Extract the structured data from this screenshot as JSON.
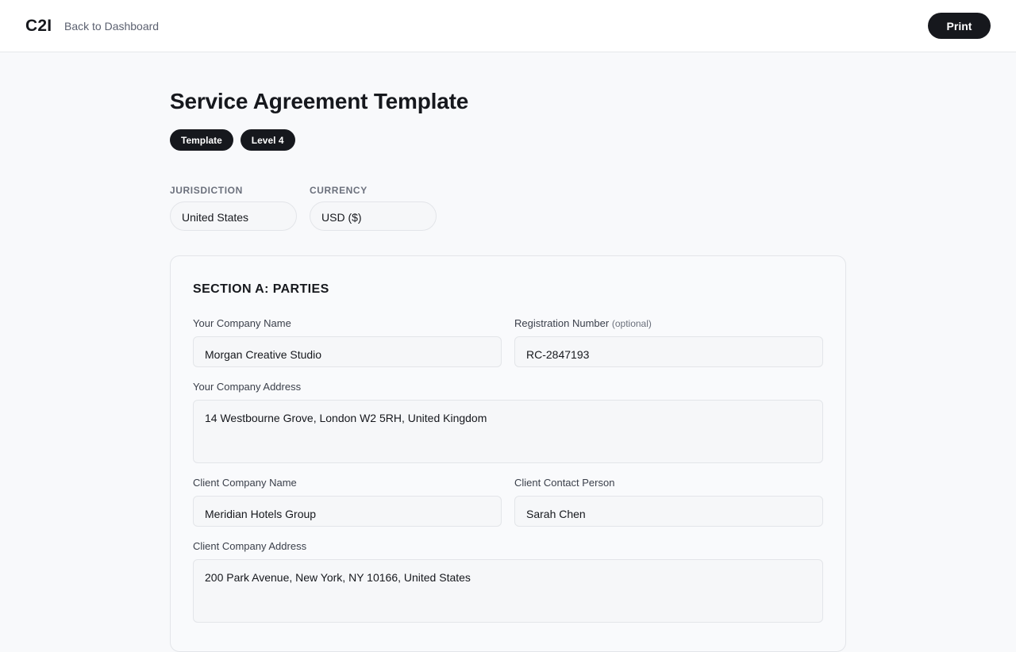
{
  "header": {
    "logo": "C2I",
    "back_link": "Back to Dashboard",
    "print_label": "Print"
  },
  "page": {
    "title": "Service Agreement Template",
    "tags": [
      "Template",
      "Level 4"
    ]
  },
  "meta": {
    "jurisdiction_label": "JURISDICTION",
    "jurisdiction_value": "United States",
    "currency_label": "CURRENCY",
    "currency_value": "USD ($)"
  },
  "section_a": {
    "title": "SECTION A: PARTIES",
    "your_company_name": {
      "label": "Your Company Name",
      "value": "Morgan Creative Studio"
    },
    "registration_number": {
      "label": "Registration Number",
      "optional": "(optional)",
      "value": "RC-2847193"
    },
    "your_company_address": {
      "label": "Your Company Address",
      "value": "14 Westbourne Grove, London W2 5RH, United Kingdom"
    },
    "client_company_name": {
      "label": "Client Company Name",
      "value": "Meridian Hotels Group"
    },
    "client_contact_person": {
      "label": "Client Contact Person",
      "value": "Sarah Chen"
    },
    "client_company_address": {
      "label": "Client Company Address",
      "value": "200 Park Avenue, New York, NY 10166, United States"
    }
  },
  "colors": {
    "primary": "#16181d",
    "page_background": "#f8f9fb",
    "muted_text": "#6b707c"
  }
}
